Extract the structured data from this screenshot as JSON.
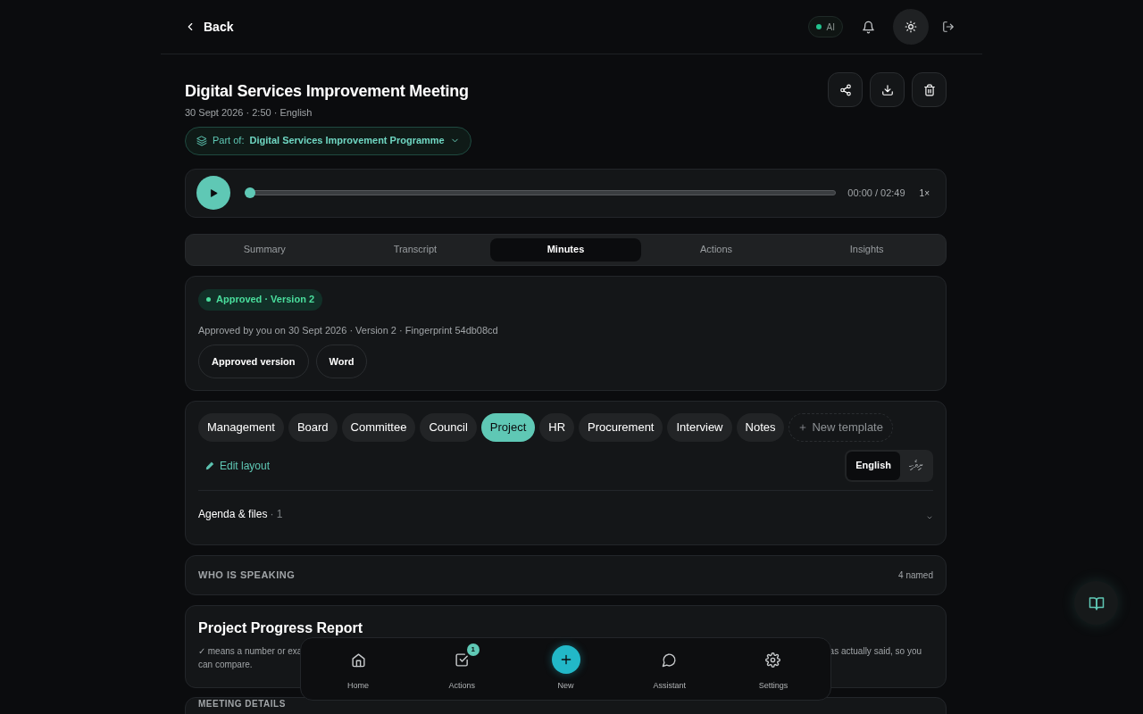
{
  "header": {
    "back_label": "Back",
    "ai_badge": "AI"
  },
  "meeting": {
    "title": "Digital Services Improvement Meeting",
    "meta": "30 Sept 2026 · 2:50 · English",
    "part_of_label": "Part of:",
    "part_of_value": "Digital Services Improvement Programme"
  },
  "player": {
    "level": 0,
    "time": "00:00 / 02:49",
    "speed": "1×"
  },
  "tabs": [
    {
      "label": "Summary",
      "selected": false
    },
    {
      "label": "Transcript",
      "selected": false
    },
    {
      "label": "Minutes",
      "selected": true
    },
    {
      "label": "Actions",
      "selected": false
    },
    {
      "label": "Insights",
      "selected": false
    }
  ],
  "approval": {
    "badge": "Approved · Version 2",
    "detail": "Approved by you on 30 Sept 2026 · Version 2 · Fingerprint 54db08cd",
    "buttons": [
      "Approved version",
      "Word"
    ]
  },
  "templates": [
    {
      "label": "Management",
      "selected": false
    },
    {
      "label": "Board",
      "selected": false
    },
    {
      "label": "Committee",
      "selected": false
    },
    {
      "label": "Council",
      "selected": false
    },
    {
      "label": "Project",
      "selected": true
    },
    {
      "label": "HR",
      "selected": false
    },
    {
      "label": "Procurement",
      "selected": false
    },
    {
      "label": "Interview",
      "selected": false
    },
    {
      "label": "Notes",
      "selected": false
    }
  ],
  "new_template": "New template",
  "edit_layout": "Edit layout",
  "languages": [
    {
      "label": "English",
      "selected": true
    },
    {
      "label": "ދިވެހި",
      "selected": false
    }
  ],
  "agenda": {
    "label": "Agenda & files",
    "count": "· 1"
  },
  "speakers": {
    "heading": "WHO IS SPEAKING",
    "count": "4 named"
  },
  "report": {
    "title": "Project Progress Report",
    "fragments": [
      "✓ means a number or exa",
      "as actually said, so you",
      "can compare."
    ]
  },
  "meeting_details": {
    "heading": "MEETING DETAILS"
  },
  "nav": [
    {
      "label": "Home",
      "kind": "link"
    },
    {
      "label": "Actions",
      "kind": "link",
      "badge": "1"
    },
    {
      "label": "New",
      "kind": "primary"
    },
    {
      "label": "Assistant",
      "kind": "link"
    },
    {
      "label": "Settings",
      "kind": "link"
    }
  ]
}
